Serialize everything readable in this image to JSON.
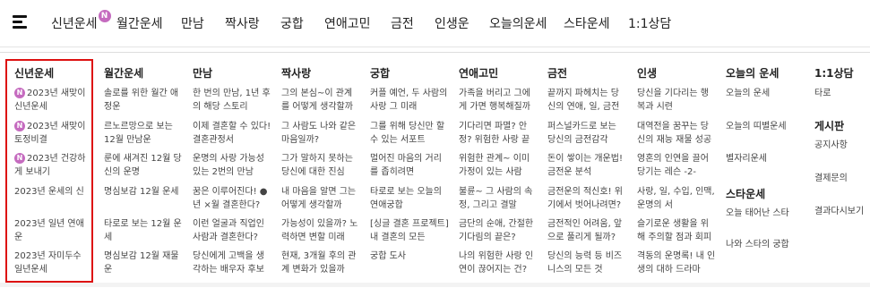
{
  "nav": {
    "items": [
      {
        "label": "신년운세",
        "badge": "N"
      },
      {
        "label": "월간운세"
      },
      {
        "label": "만남"
      },
      {
        "label": "짝사랑"
      },
      {
        "label": "궁합"
      },
      {
        "label": "연애고민"
      },
      {
        "label": "금전"
      },
      {
        "label": "인생운"
      },
      {
        "label": "오늘의운세"
      },
      {
        "label": "스타운세"
      },
      {
        "label": "1:1상담"
      }
    ]
  },
  "menu": {
    "columns": [
      {
        "title": "신년운세",
        "items": [
          {
            "label": "2023년 새맞이 신년운세",
            "badge": "N"
          },
          {
            "label": "2023년 새맞이 토정비결",
            "badge": "N"
          },
          {
            "label": "2023년 건강하게 보내기",
            "badge": "N"
          },
          {
            "label": "2023년 운세의 신"
          },
          {
            "label": "2023년 일년 연애운"
          },
          {
            "label": "2023년 자미두수 일년운세"
          }
        ]
      },
      {
        "title": "월간운세",
        "items": [
          {
            "label": "솔로를 위한 월간 애정운"
          },
          {
            "label": "르노르망으로 보는 12월 만남운"
          },
          {
            "label": "룬에 새겨진 12월 당신의 운명"
          },
          {
            "label": "명심보감 12월 운세"
          },
          {
            "label": "타로로 보는 12월 운세"
          },
          {
            "label": "명심보감 12월 재물운"
          }
        ]
      },
      {
        "title": "만남",
        "items": [
          {
            "label": "한 번의 만남, 1년 후의 해당 스토리"
          },
          {
            "label": "이제 결혼할 수 있다! 결혼관정서"
          },
          {
            "label": "운명의 사랑 가능성 있는 2번의 만남"
          },
          {
            "label": "꿈은 이루어진다! ● 년 ×월 결혼한다?"
          },
          {
            "label": "이런 얼굴과 직업인 사람과 결혼한다?"
          },
          {
            "label": "당신에게 고백을 생각하는 배우자 후보"
          }
        ]
      },
      {
        "title": "짝사랑",
        "items": [
          {
            "label": "그의 본심~이 관계를 어떻게 생각할까"
          },
          {
            "label": "그 사람도 나와 같은 마음일까?"
          },
          {
            "label": "그가 말하지 못하는 당신에 대한 진심"
          },
          {
            "label": "내 마음을 알면 그는 어떻게 생각할까"
          },
          {
            "label": "가능성이 있을까? 노력하면 변할 미래"
          },
          {
            "label": "현재, 3개월 후의 관계 변화가 있을까"
          }
        ]
      },
      {
        "title": "궁합",
        "items": [
          {
            "label": "커플 예언, 두 사람의 사랑 그 미래"
          },
          {
            "label": "그를 위해 당신만 할 수 있는 서포트"
          },
          {
            "label": "멀어진 마음의 거리를 좁히려면"
          },
          {
            "label": "타로로 보는 오늘의 연애궁합"
          },
          {
            "label": "[싱글 결혼 프로젝트] 내 결혼의 모든"
          },
          {
            "label": "궁합 도사"
          }
        ]
      },
      {
        "title": "연애고민",
        "items": [
          {
            "label": "가족을 버리고 그에게 가면 행복해질까"
          },
          {
            "label": "기다리면 파멸? 안정? 위험한 사랑 끝"
          },
          {
            "label": "위험한 관계~ 이미 가정이 있는 사람"
          },
          {
            "label": "불륜~ 그 사람의 속정, 그리고 결말"
          },
          {
            "label": "금단의 순애, 간절한 기다림의 끝은?"
          },
          {
            "label": "나의 위험한 사랑 인연이 끊어지는 건?"
          }
        ]
      },
      {
        "title": "금전",
        "items": [
          {
            "label": "끝까지 파헤치는 당신의 연애, 일, 금전"
          },
          {
            "label": "퍼스널카드로 보는 당신의 금전감각"
          },
          {
            "label": "돈이 쌓이는 개운법! 금전운 분석"
          },
          {
            "label": "금전운의 적신호! 위기에서 벗어나려면?"
          },
          {
            "label": "금전적인 어려움, 앞으로 풀리게 될까?"
          },
          {
            "label": "당신의 능력 등 비즈니스의 모든 것"
          }
        ]
      },
      {
        "title": "인생",
        "items": [
          {
            "label": "당신을 기다리는 행복과 시련"
          },
          {
            "label": "대역전을 꿈꾸는 당신의 재능 재물 성공"
          },
          {
            "label": "영혼의 인연을 끌어당기는 레슨 -2-"
          },
          {
            "label": "사랑, 일, 수입, 인맥, 운명의 서"
          },
          {
            "label": "슬기로운 생활을 위해 주의할 점과 회피"
          },
          {
            "label": "격동의 운명록! 내 인생의 대하 드라마"
          }
        ]
      },
      {
        "title": "오늘의 운세",
        "items": [
          {
            "label": "오늘의 운세"
          },
          {
            "label": "오늘의 띠별운세"
          },
          {
            "label": "별자리운세"
          }
        ],
        "subtitle": "스타운세",
        "subitems": [
          {
            "label": "오늘 태어난 스타"
          },
          {
            "label": "나와 스타의 궁합"
          }
        ]
      },
      {
        "title": "1:1상담",
        "items": [
          {
            "label": "타로"
          }
        ],
        "subtitle": "게시판",
        "subitems": [
          {
            "label": "공지사항"
          },
          {
            "label": "결제문의"
          },
          {
            "label": "결과다시보기"
          }
        ]
      }
    ]
  }
}
